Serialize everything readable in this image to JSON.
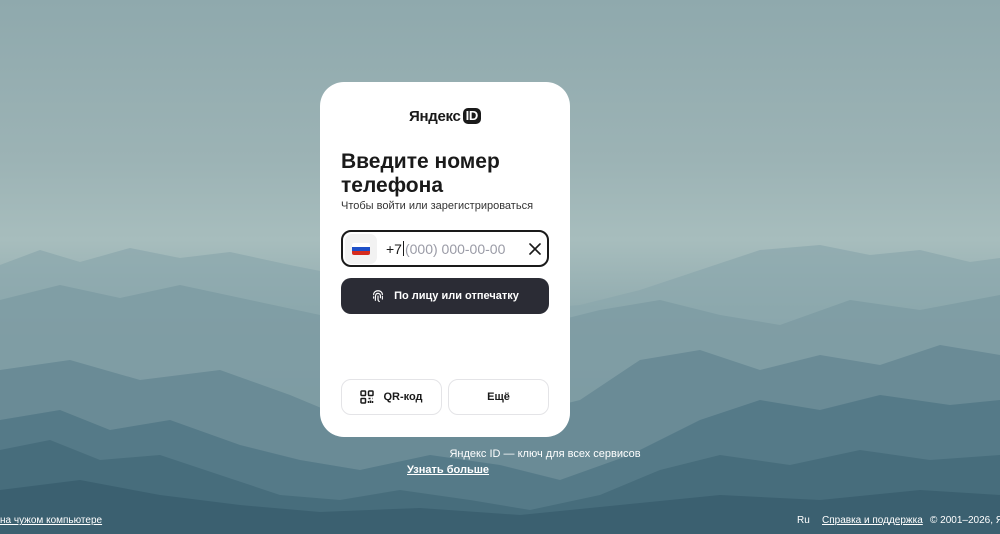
{
  "card": {
    "logo_text": "Яндекс",
    "logo_badge": "ID",
    "title": "Введите номер телефона",
    "subtitle": "Чтобы войти или зарегистрироваться",
    "country_flag": "russia-flag-icon",
    "phone_code": "+7",
    "phone_value": "",
    "phone_placeholder": "(000) 000-00-00",
    "biometric_button": "По лицу или отпечатку",
    "qr_button": "QR-код",
    "more_button": "Ещё"
  },
  "below_card": {
    "tagline": "Яндекс ID — ключ для всех сервисов",
    "learn_more": "Узнать больше"
  },
  "footer": {
    "left_link": "на чужом компьютере",
    "language": "Ru",
    "help_link": "Справка и поддержка",
    "copyright": "© 2001–2026, Я"
  },
  "colors": {
    "primary_button": "#2b2c35",
    "card_bg": "#ffffff",
    "placeholder": "#9a9ba6"
  }
}
